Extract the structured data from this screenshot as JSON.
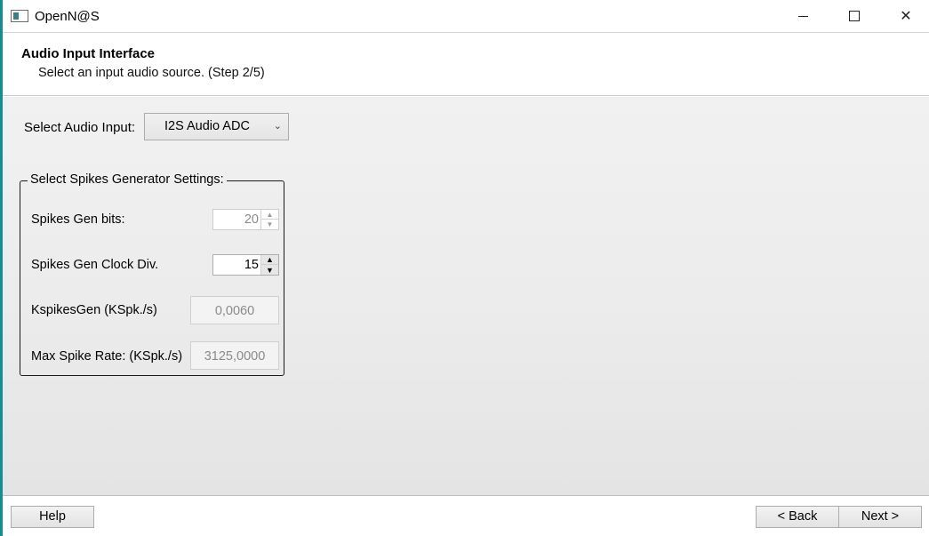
{
  "window": {
    "title": "OpenN@S"
  },
  "header": {
    "title": "Audio Input Interface",
    "subtitle": "Select an input audio source. (Step 2/5)"
  },
  "audio_input": {
    "label": "Select Audio Input:",
    "selected": "I2S Audio ADC"
  },
  "spikes_group": {
    "title": "Select Spikes Generator Settings:",
    "gen_bits_label": "Spikes Gen bits:",
    "gen_bits_value": "20",
    "clock_div_label": "Spikes Gen Clock Div.",
    "clock_div_value": "15",
    "kspikes_label": "KspikesGen (KSpk./s)",
    "kspikes_value": "0,0060",
    "max_rate_label": "Max Spike Rate: (KSpk./s)",
    "max_rate_value": "3125,0000"
  },
  "footer": {
    "help_label": "Help",
    "back_label": "< Back",
    "next_label": "Next >"
  },
  "icons": {
    "app": "app-window-icon",
    "minimize": "minimize-icon",
    "maximize": "maximize-icon",
    "close": "close-icon",
    "dropdown": "chevron-down-icon",
    "spin_up": "arrow-up-icon",
    "spin_down": "arrow-down-icon"
  },
  "colors": {
    "accent_border": "#1e8a8f"
  }
}
